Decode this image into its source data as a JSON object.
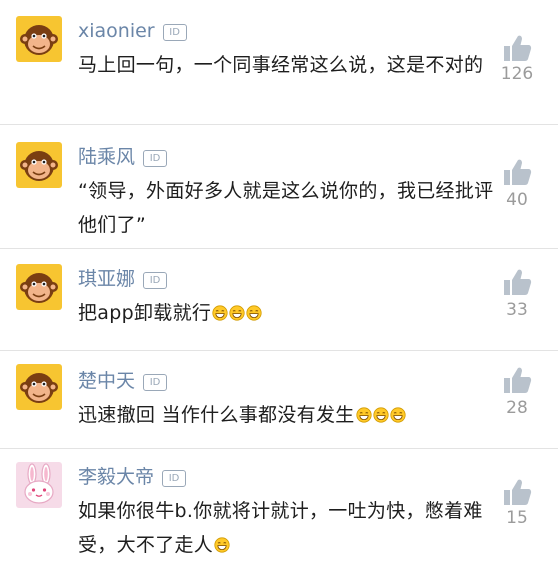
{
  "comments": [
    {
      "username": "xiaonier",
      "id_badge": "ID",
      "avatar": "monkey-avatar",
      "content": "马上回一句，一个同事经常这么说，这是不对的",
      "emojis": 0,
      "likes": "126"
    },
    {
      "username": "陆乘风",
      "id_badge": "ID",
      "avatar": "monkey-avatar",
      "content": "“领导，外面好多人就是这么说你的，我已经批评他们了”",
      "emojis": 0,
      "likes": "40"
    },
    {
      "username": "琪亚娜",
      "id_badge": "ID",
      "avatar": "monkey-avatar",
      "content": "把app卸载就行",
      "emojis": 3,
      "likes": "33"
    },
    {
      "username": "楚中天",
      "id_badge": "ID",
      "avatar": "monkey-avatar",
      "content": "迅速撤回 当作什么事都没有发生",
      "emojis": 3,
      "likes": "28"
    },
    {
      "username": "李毅大帝",
      "id_badge": "ID",
      "avatar": "rabbit-avatar",
      "content": "如果你很牛b.你就将计就计，一吐为快，憋着难受，大不了走人",
      "emojis": 1,
      "likes": "15"
    }
  ],
  "colors": {
    "username": "#6b86a8",
    "text": "#1e1e1e",
    "count": "#9b9b9b",
    "divider": "#e3e3e3",
    "monkey_bg": "#f7c531",
    "rabbit_bg": "#f6dbe8"
  },
  "icons": {
    "like": "thumbs-up-icon",
    "id": "id-badge-icon",
    "emoji": "grin-emoji-icon"
  }
}
